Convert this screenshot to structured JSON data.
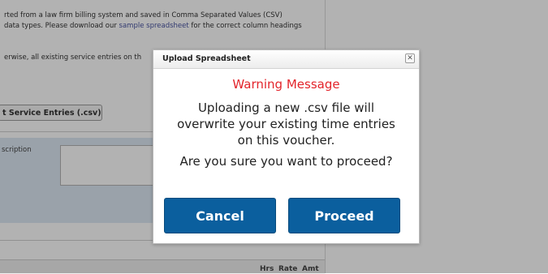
{
  "background": {
    "line1": "rted from a law firm billing system and saved in Comma Separated Values (CSV)",
    "line2_prefix": "data types. Please download our ",
    "line2_link": "sample spreadsheet",
    "line2_suffix": " for the correct column headings",
    "line3": "erwise, all existing service entries on th",
    "import_button": "t Service Entries (.csv)",
    "description_label": "scription",
    "table_headers": [
      "Hrs",
      "Rate",
      "Amt"
    ]
  },
  "dialog": {
    "title": "Upload Spreadsheet",
    "close_symbol": "✕",
    "warning_title": "Warning Message",
    "message_lines": [
      "Uploading a new .csv file will",
      "overwrite your existing time entries",
      "on this voucher.",
      "Are you sure you want to proceed?"
    ],
    "cancel_label": "Cancel",
    "proceed_label": "Proceed"
  },
  "colors": {
    "button_blue": "#0b5f9e",
    "warning_red": "#e3242b"
  }
}
